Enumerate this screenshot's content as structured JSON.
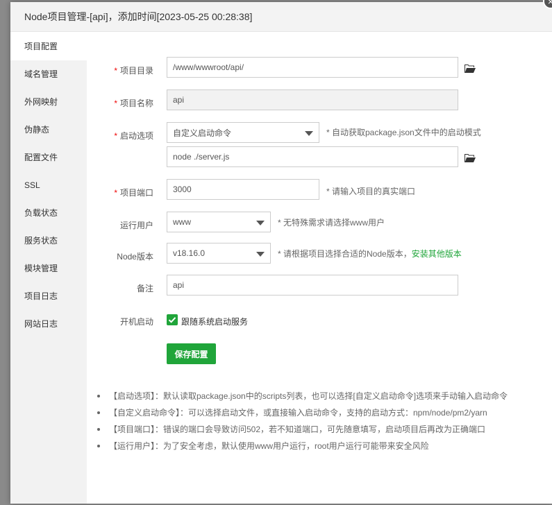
{
  "dialog": {
    "title": "Node项目管理-[api]，添加时间[2023-05-25 00:28:38]",
    "close_symbol": "×"
  },
  "sidebar": {
    "items": [
      {
        "label": "项目配置",
        "active": true
      },
      {
        "label": "域名管理"
      },
      {
        "label": "外网映射"
      },
      {
        "label": "伪静态"
      },
      {
        "label": "配置文件"
      },
      {
        "label": "SSL"
      },
      {
        "label": "负载状态"
      },
      {
        "label": "服务状态"
      },
      {
        "label": "模块管理"
      },
      {
        "label": "项目日志"
      },
      {
        "label": "网站日志"
      }
    ]
  },
  "form": {
    "required_mark": "*",
    "dir": {
      "label": "项目目录",
      "value": "/www/wwwroot/api/"
    },
    "name": {
      "label": "项目名称",
      "value": "api"
    },
    "start": {
      "label": "启动选项",
      "selected": "自定义启动命令",
      "hint": "* 自动获取package.json文件中的启动模式",
      "command": "node ./server.js"
    },
    "port": {
      "label": "项目端口",
      "value": "3000",
      "hint": "* 请输入项目的真实端口"
    },
    "user": {
      "label": "运行用户",
      "selected": "www",
      "hint": "* 无特殊需求请选择www用户"
    },
    "node": {
      "label": "Node版本",
      "selected": "v18.16.0",
      "hint": "* 请根据项目选择合适的Node版本，",
      "link": "安装其他版本"
    },
    "remark": {
      "label": "备注",
      "value": "api"
    },
    "boot": {
      "label": "开机启动",
      "checkbox_label": "跟随系统启动服务",
      "checked": true
    },
    "save_label": "保存配置"
  },
  "notes": [
    "【启动选项】：默认读取package.json中的scripts列表，也可以选择[自定义启动命令]选项来手动输入启动命令",
    "【自定义启动命令】：可以选择启动文件，或直接输入启动命令，支持的启动方式：npm/node/pm2/yarn",
    "【项目端口】：错误的端口会导致访问502，若不知道端口，可先随意填写，启动项目后再改为正确端口",
    "【运行用户】：为了安全考虑，默认使用www用户运行，root用户运行可能带来安全风险"
  ],
  "colors": {
    "accent": "#20a53a",
    "required": "#ef0808"
  }
}
